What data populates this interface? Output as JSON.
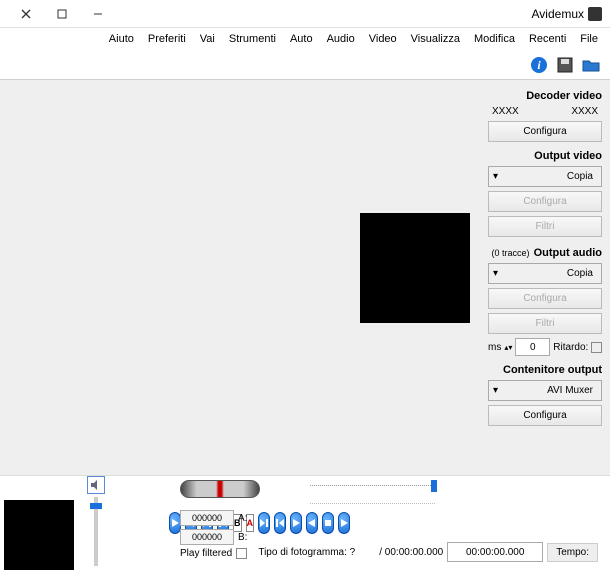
{
  "app": {
    "title": "Avidemux"
  },
  "menu": {
    "file": "File",
    "recenti": "Recenti",
    "modifica": "Modifica",
    "visualizza": "Visualizza",
    "video": "Video",
    "audio": "Audio",
    "auto": "Auto",
    "strumenti": "Strumenti",
    "vai": "Vai",
    "preferiti": "Preferiti",
    "aiuto": "Aiuto"
  },
  "sections": {
    "decoder_video": {
      "title": "Decoder video",
      "val1": "XXXX",
      "val2": "XXXX",
      "configura": "Configura"
    },
    "output_video": {
      "title": "Output video",
      "mode": "Copia",
      "configura": "Configura",
      "filtri": "Filtri"
    },
    "output_audio": {
      "title": "Output audio",
      "tracks": "(0 tracce)",
      "mode": "Copia",
      "configura": "Configura",
      "filtri": "Filtri"
    },
    "ritardo": {
      "label": "Ritardo:",
      "value": "0",
      "unit": "ms"
    },
    "contenitore": {
      "title": "Contenitore output",
      "mode": "AVI Muxer",
      "configura": "Configura"
    }
  },
  "ab": {
    "a_label": "A:",
    "a_value": "000000",
    "b_label": "B:",
    "b_value": "000000"
  },
  "play_filtered": "Play filtered",
  "tempo": {
    "label": "Tempo:",
    "current": "00:00:00.000",
    "total": "/ 00:00:00.000",
    "frame_type_label": "Tipo di fotogramma: ?"
  },
  "icons": {
    "open": "open-icon",
    "save": "save-icon",
    "info": "info-icon"
  }
}
